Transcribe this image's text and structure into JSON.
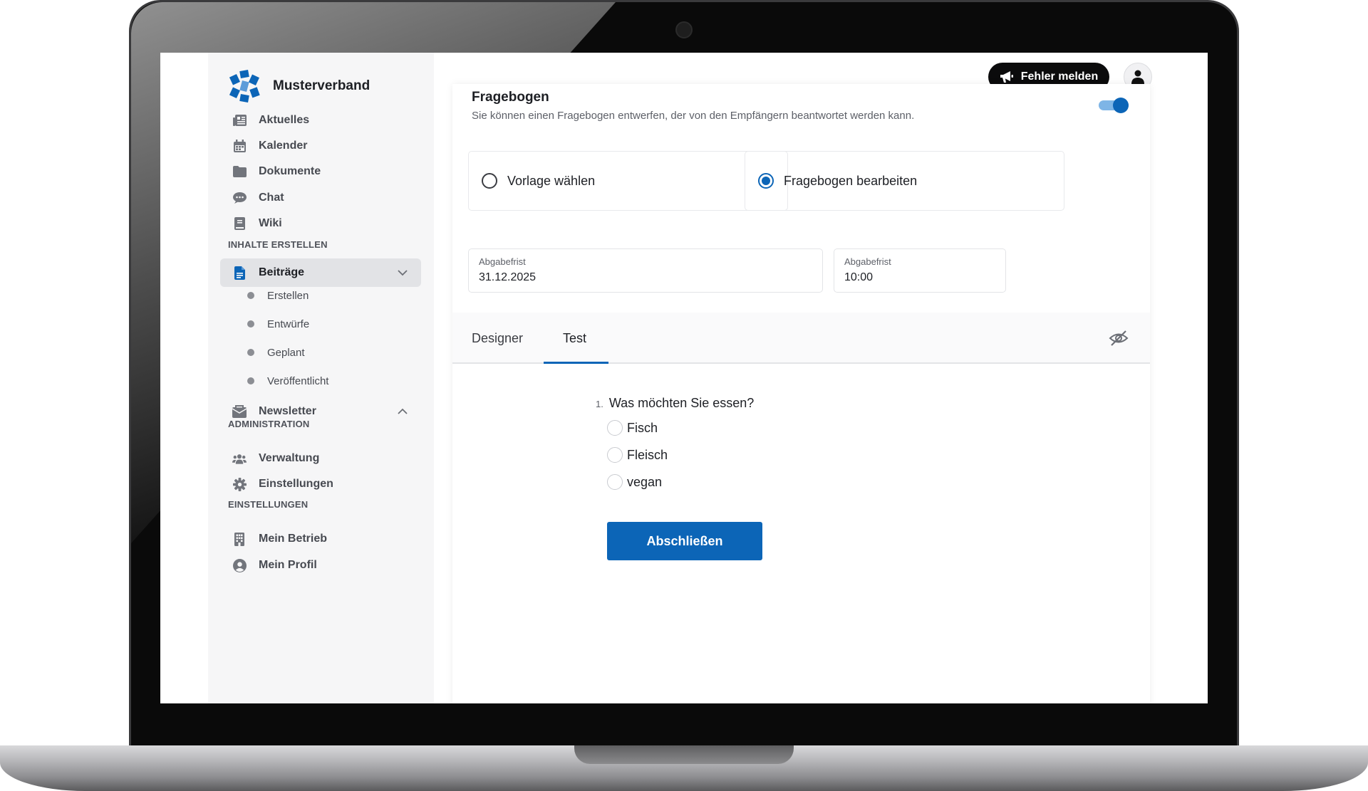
{
  "app": {
    "brand_name": "Musterverband"
  },
  "topbar": {
    "report_label": "Fehler melden"
  },
  "sidebar": {
    "items": [
      {
        "label": "Aktuelles",
        "icon": "newspaper-icon"
      },
      {
        "label": "Kalender",
        "icon": "calendar-icon"
      },
      {
        "label": "Dokumente",
        "icon": "folder-icon"
      },
      {
        "label": "Chat",
        "icon": "chat-icon"
      },
      {
        "label": "Wiki",
        "icon": "book-icon"
      }
    ],
    "section_create": "INHALTE ERSTELLEN",
    "posts": {
      "label": "Beiträge",
      "icon": "document-icon",
      "expanded": true,
      "sub_items": [
        "Erstellen",
        "Entwürfe",
        "Geplant",
        "Veröffentlicht"
      ]
    },
    "newsletter": {
      "label": "Newsletter",
      "icon": "envelope-icon"
    },
    "section_admin": "ADMINISTRATION",
    "admin_items": [
      {
        "label": "Verwaltung",
        "icon": "users-icon"
      },
      {
        "label": "Einstellungen",
        "icon": "gear-icon"
      }
    ],
    "section_settings": "EINSTELLUNGEN",
    "settings_items": [
      {
        "label": "Mein Betrieb",
        "icon": "building-icon"
      },
      {
        "label": "Mein Profil",
        "icon": "user-circle-icon"
      }
    ]
  },
  "questionnaire": {
    "title": "Fragebogen",
    "description": "Sie können einen Fragebogen entwerfen, der von den Empfängern beantwortet werden kann.",
    "enabled": true,
    "options": [
      {
        "label": "Vorlage wählen",
        "selected": false
      },
      {
        "label": "Fragebogen bearbeiten",
        "selected": true
      }
    ],
    "deadline_date": {
      "label": "Abgabefrist",
      "value": "31.12.2025"
    },
    "deadline_time": {
      "label": "Abgabefrist",
      "value": "10:00"
    },
    "tabs": [
      {
        "label": "Designer",
        "active": false
      },
      {
        "label": "Test",
        "active": true
      }
    ],
    "question": {
      "number": "1.",
      "text": "Was möchten Sie essen?",
      "answers": [
        "Fisch",
        "Fleisch",
        "vegan"
      ]
    },
    "finish_label": "Abschließen"
  },
  "colors": {
    "accent": "#0c65b7",
    "sidebar_bg": "#f6f6f7",
    "button_dark": "#0b0b0c"
  }
}
